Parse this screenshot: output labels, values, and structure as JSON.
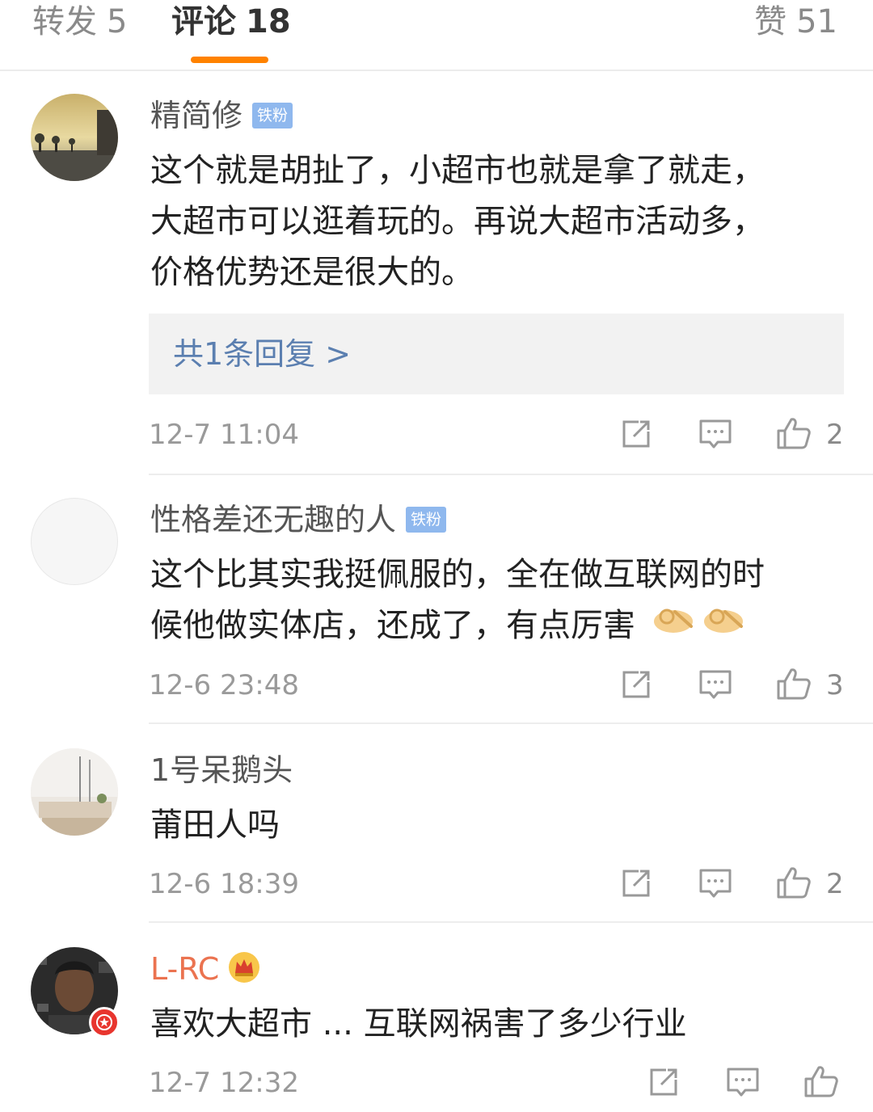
{
  "tabs": {
    "repost": {
      "label": "转发",
      "count": "5"
    },
    "comment": {
      "label": "评论",
      "count": "18"
    },
    "like": {
      "label": "赞",
      "count": "51"
    },
    "active_color": "#ff8200"
  },
  "comments": [
    {
      "username": "精简修",
      "badge": "铁粉",
      "text_lines": [
        "这个就是胡扯了，小超市也就是拿了就走，",
        "大超市可以逛着玩的。再说大超市活动多，",
        "价格优势还是很大的。"
      ],
      "reply_link": "共1条回复 >",
      "time": "12-7 11:04",
      "likes": "2"
    },
    {
      "username": "性格差还无趣的人",
      "badge": "铁粉",
      "text_lines": [
        "这个比其实我挺佩服的，全在做互联网的时",
        "候他做实体店，还成了，有点厉害"
      ],
      "emoji": "ok-hand-emoji",
      "time": "12-6 23:48",
      "likes": "3"
    },
    {
      "username": "1号呆鹅头",
      "text_lines": [
        "莆田人吗"
      ],
      "time": "12-6 18:39",
      "likes": "2"
    },
    {
      "username": "L-RC",
      "user_icon": "crown-icon",
      "text_lines": [
        "喜欢大超市 ... 互联网祸害了多少行业"
      ],
      "time": "12-7 12:32",
      "likes": ""
    }
  ],
  "colors": {
    "vip_name": "#eb7350",
    "fan_badge": "#8fb8ee",
    "reply_link": "#5b7fb0",
    "divider": "#ededed"
  }
}
